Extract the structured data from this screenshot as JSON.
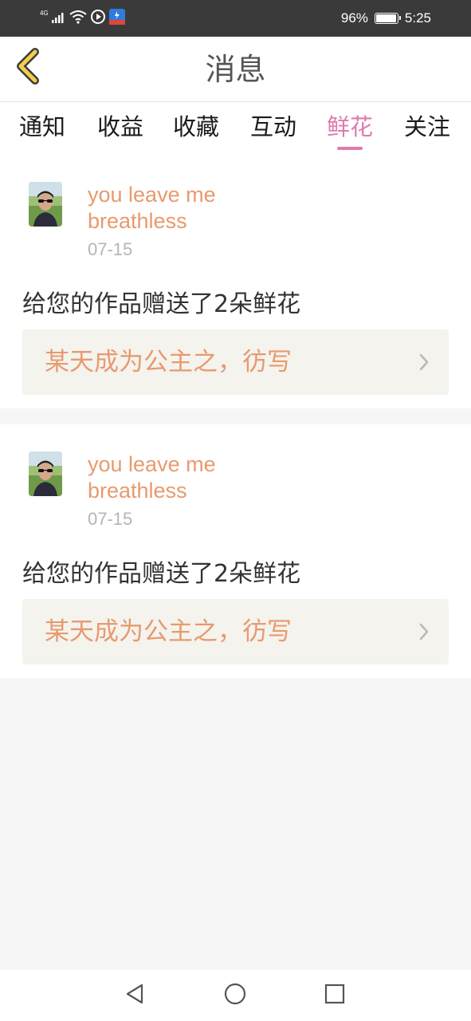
{
  "status_bar": {
    "network": "4G",
    "battery": "96%",
    "battery_level": 0.96,
    "time": "5:25",
    "icons": [
      "signal-icon",
      "wifi-icon",
      "media-icon",
      "app-notification-icon",
      "battery-icon"
    ]
  },
  "header": {
    "title": "消息",
    "back_icon": "chevron-left-icon",
    "accent_color": "#f2cf4a"
  },
  "tabs": [
    {
      "label": "通知",
      "active": false
    },
    {
      "label": "收益",
      "active": false
    },
    {
      "label": "收藏",
      "active": false
    },
    {
      "label": "互动",
      "active": false
    },
    {
      "label": "鲜花",
      "active": true
    },
    {
      "label": "关注",
      "active": false
    }
  ],
  "colors": {
    "active_tab": "#e07aae",
    "username": "#e89a6e",
    "work_title": "#e89a6e",
    "date": "#b5b5b5",
    "card_link_bg": "#f4f3ee"
  },
  "messages": [
    {
      "username": "you leave me breathless",
      "date": "07-15",
      "text": "给您的作品赠送了2朵鲜花",
      "work_title": "某天成为公主之，彷写"
    },
    {
      "username": "you leave me breathless",
      "date": "07-15",
      "text": "给您的作品赠送了2朵鲜花",
      "work_title": "某天成为公主之，彷写"
    }
  ],
  "nav_bar": {
    "icons": [
      "back-triangle-icon",
      "home-circle-icon",
      "recents-square-icon"
    ]
  }
}
